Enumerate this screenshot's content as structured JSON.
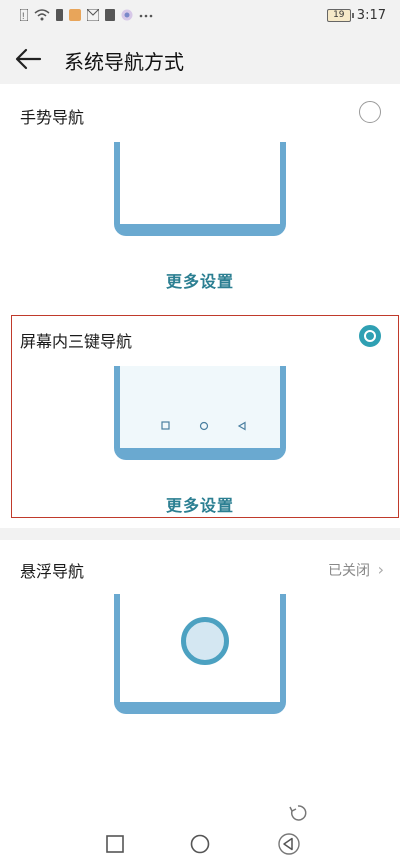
{
  "status_bar": {
    "time": "3:17",
    "battery": "19",
    "icons": [
      "notification-icon",
      "wifi-icon",
      "sim-icon",
      "app-icon",
      "mail-icon",
      "app-icon",
      "chrome-icon",
      "more-icon"
    ]
  },
  "header": {
    "title": "系统导航方式",
    "back_icon": "back-arrow-icon"
  },
  "options": [
    {
      "label": "手势导航",
      "selected": false,
      "more_settings": "更多设置"
    },
    {
      "label": "屏幕内三键导航",
      "selected": true,
      "more_settings": "更多设置"
    },
    {
      "label": "悬浮导航",
      "status": "已关闭"
    }
  ],
  "colors": {
    "accent": "#2c7f92",
    "radio_on": "#2fa0b3",
    "phone_frame": "#6aa9d0",
    "highlight_border": "#c03a2b"
  },
  "nav_bar": {
    "icons": [
      "recent-apps-icon",
      "home-icon",
      "back-icon"
    ]
  }
}
